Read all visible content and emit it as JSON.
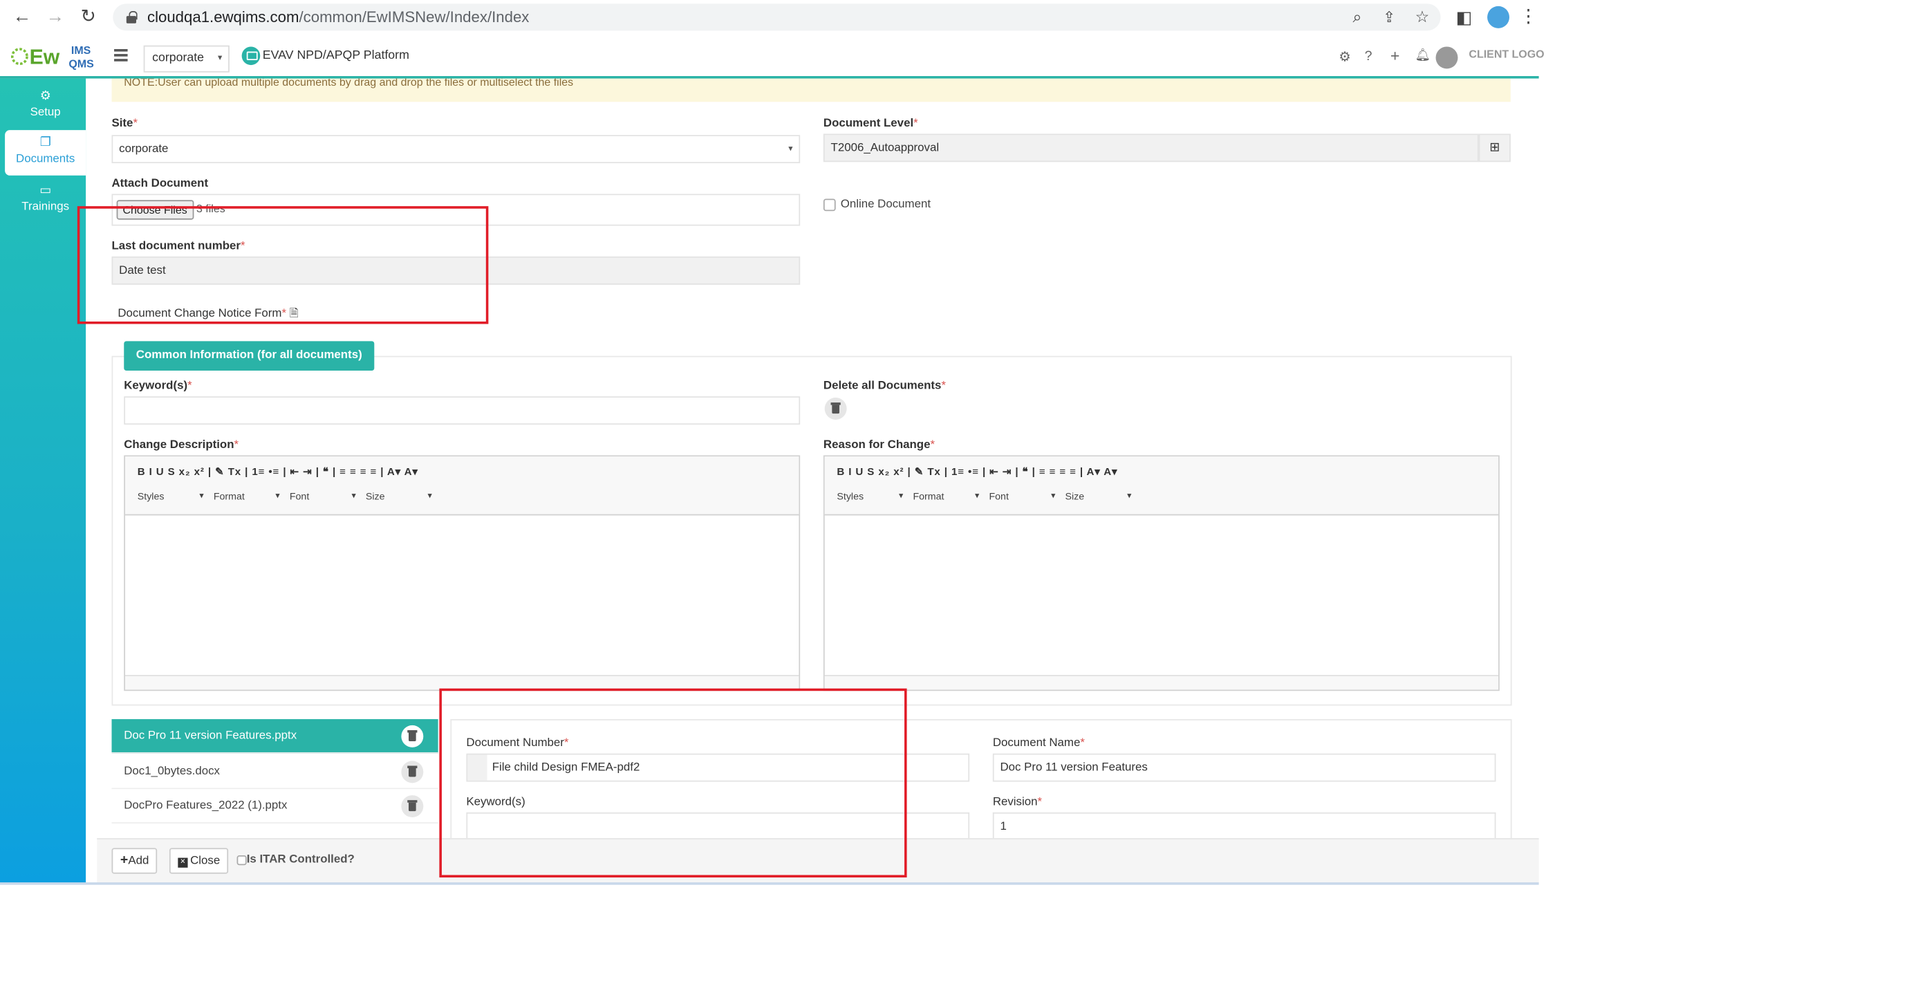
{
  "browser": {
    "url_domain": "cloudqa1.ewqims.com",
    "url_path": "/common/EwIMSNew/Index/Index"
  },
  "header": {
    "logo_text": "EwIMS QMS",
    "site_select": "corporate",
    "platform": "EVAV NPD/APQP Platform",
    "client_logo": "CLIENT LOGO"
  },
  "sidebar": {
    "items": [
      {
        "label": "Setup"
      },
      {
        "label": "Documents"
      },
      {
        "label": "Trainings"
      }
    ]
  },
  "form": {
    "note": "NOTE:User can upload multiple documents by drag and drop the files or multiselect the files",
    "site_label": "Site",
    "site_value": "corporate",
    "doc_level_label": "Document Level",
    "doc_level_value": "T2006_Autoapproval",
    "attach_label": "Attach Document",
    "choose_files": "Choose Files",
    "files_count": "3 files",
    "online_doc_label": "Online Document",
    "last_doc_label": "Last document number",
    "last_doc_value": "Date test",
    "dcn_label": "Document Change Notice Form",
    "required_mark": "*"
  },
  "common": {
    "tab_label": "Common Information (for all documents)",
    "keywords_label": "Keyword(s)",
    "delete_all_label": "Delete all Documents",
    "change_desc_label": "Change Description",
    "reason_label": "Reason for Change",
    "toolbar_row1": "B  I  U  S  x₂  x²  |  ✎  Tx  |  1≡  •≡  |  ⇤  ⇥  |  ❝  |  ≡  ≡  ≡  ≡  |  A▾  A▾",
    "toolbar_styles": "Styles",
    "toolbar_format": "Format",
    "toolbar_font": "Font",
    "toolbar_size": "Size"
  },
  "documents": {
    "list": [
      {
        "name": "Doc Pro 11 version Features.pptx"
      },
      {
        "name": "Doc1_0bytes.docx"
      },
      {
        "name": "DocPro Features_2022 (1).pptx"
      }
    ],
    "doc_number_label": "Document Number",
    "doc_number_value": "File child Design FMEA-pdf2",
    "doc_name_label": "Document Name",
    "doc_name_value": "Doc Pro 11 version Features",
    "keywords_label": "Keyword(s)",
    "revision_label": "Revision",
    "revision_value": "1"
  },
  "footer": {
    "add_label": "Add",
    "close_label": "Close",
    "itar_label": "Is ITAR Controlled?"
  }
}
